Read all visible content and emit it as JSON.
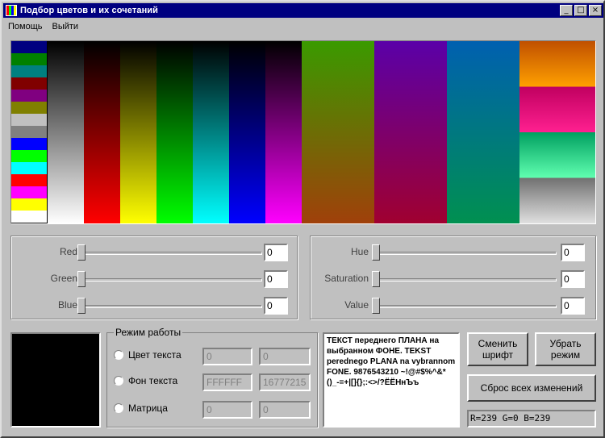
{
  "window": {
    "title": "Подбор цветов и их сочетаний",
    "minimize_label": "_",
    "maximize_label": "□",
    "close_label": "×"
  },
  "menu": {
    "items": [
      {
        "label": "Помощь"
      },
      {
        "label": "Выйти"
      }
    ]
  },
  "palette": {
    "basic_colors": [
      "#000080",
      "#008000",
      "#008080",
      "#800000",
      "#800080",
      "#808000",
      "#c0c0c0",
      "#808080",
      "#0000ff",
      "#00ff00",
      "#00ffff",
      "#ff0000",
      "#ff00ff",
      "#ffff00",
      "#ffffff"
    ],
    "gradient_columns": [
      {
        "name": "gray",
        "from": "#000000",
        "to": "#ffffff"
      },
      {
        "name": "red",
        "from": "#000000",
        "to": "#ff0000"
      },
      {
        "name": "yellow",
        "from": "#000000",
        "to": "#ffff00"
      },
      {
        "name": "green",
        "from": "#000000",
        "to": "#00ff00"
      },
      {
        "name": "cyan",
        "from": "#000000",
        "to": "#00ffff"
      },
      {
        "name": "blue",
        "from": "#000000",
        "to": "#0000ff"
      },
      {
        "name": "magenta",
        "from": "#000000",
        "to": "#ff00ff"
      },
      {
        "name": "olive-brown",
        "from": "#3a9a00",
        "to": "#a0400a"
      },
      {
        "name": "purple-crimson",
        "from": "#5a00a8",
        "to": "#a00030"
      },
      {
        "name": "teal-blue",
        "from": "#0060b0",
        "to": "#009050"
      }
    ],
    "mixed_column": [
      "#c05000",
      "#ffa000",
      "#c00060",
      "#ff2090",
      "#00a060",
      "#60ffb0",
      "#707070",
      "#e0e0e0"
    ]
  },
  "rgb": {
    "rows": [
      {
        "label": "Red",
        "value": "0",
        "level": 0
      },
      {
        "label": "Green",
        "value": "0",
        "level": 0
      },
      {
        "label": "Blue",
        "value": "0",
        "level": 0
      }
    ]
  },
  "hsv": {
    "rows": [
      {
        "label": "Hue",
        "value": "0",
        "level": 0
      },
      {
        "label": "Saturation",
        "value": "0",
        "level": 0
      },
      {
        "label": "Value",
        "value": "0",
        "level": 0
      }
    ]
  },
  "preview_color": "#000000",
  "mode": {
    "legend": "Режим работы",
    "options": [
      {
        "label": "Цвет текста",
        "hex": "0",
        "dec": "0"
      },
      {
        "label": "Фон текста",
        "hex": "FFFFFF",
        "dec": "16777215"
      },
      {
        "label": "Матрица",
        "hex": "0",
        "dec": "0"
      }
    ]
  },
  "sample_text": "ТЕКСТ переднего ПЛАНА на выбранном ФОНЕ. TEKST perednego PLANA na vybrannom FONE. 9876543210 ~!@#$%^&*()_-=+|[]{};:<>/?ЁЁНнЪъ",
  "buttons": {
    "change_font": "Сменить шрифт",
    "remove_mode": "Убрать режим",
    "reset_all": "Сброс всех изменений"
  },
  "status": "R=239 G=0 B=239"
}
